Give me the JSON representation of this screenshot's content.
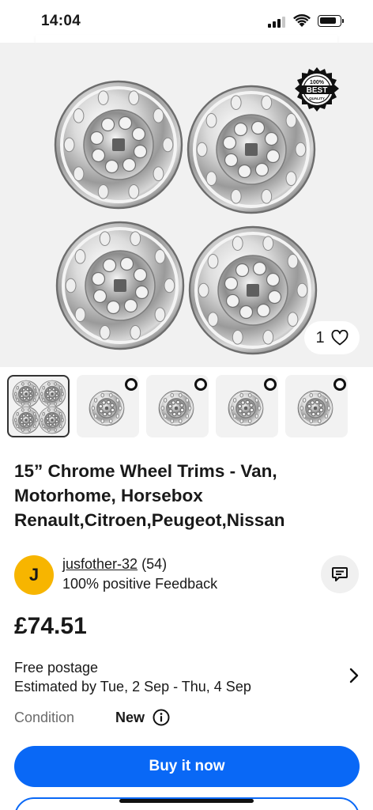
{
  "status_bar": {
    "time": "14:04",
    "battery_level": 0.85
  },
  "gallery": {
    "badge_text_top": "100%",
    "badge_text_main": "BEST",
    "badge_text_bottom": "QUALITY",
    "like_count": "1",
    "thumbnail_count": 5
  },
  "listing": {
    "title": "15” Chrome Wheel Trims - Van, Motorhome, Horsebox Renault,Citroen,Peugeot,Nissan",
    "price": "£74.51"
  },
  "seller": {
    "avatar_letter": "J",
    "name": "jusfother-32",
    "score": "(54)",
    "feedback": "100% positive Feedback"
  },
  "shipping": {
    "line1": "Free postage",
    "line2": "Estimated by Tue, 2 Sep - Thu, 4 Sep"
  },
  "condition": {
    "label": "Condition",
    "value": "New"
  },
  "actions": {
    "buy_label": "Buy it now"
  },
  "colors": {
    "accent": "#0968f6",
    "avatar": "#f7b500",
    "text": "#191919"
  },
  "icons": [
    "signal-icon",
    "wifi-icon",
    "battery-icon",
    "best-quality-badge",
    "heart-icon",
    "message-icon",
    "chevron-right-icon",
    "info-icon"
  ]
}
